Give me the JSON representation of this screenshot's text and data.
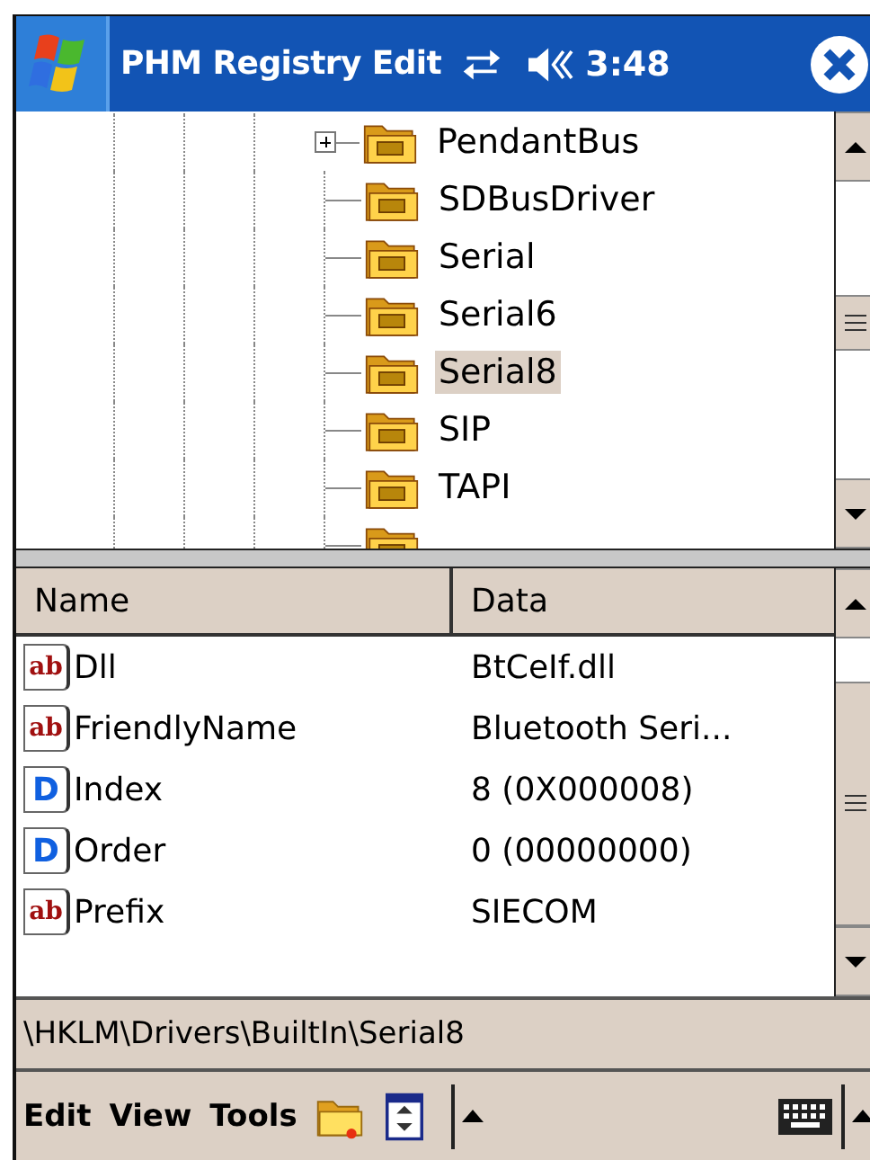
{
  "title_bar": {
    "title": "PHM Registry Edit",
    "time": "3:48"
  },
  "tree": {
    "items": [
      {
        "label": "PendantBus",
        "expandable": true,
        "selected": false
      },
      {
        "label": "SDBusDriver",
        "expandable": false,
        "selected": false
      },
      {
        "label": "Serial",
        "expandable": false,
        "selected": false
      },
      {
        "label": "Serial6",
        "expandable": false,
        "selected": false
      },
      {
        "label": "Serial8",
        "expandable": false,
        "selected": true
      },
      {
        "label": "SIP",
        "expandable": false,
        "selected": false
      },
      {
        "label": "TAPI",
        "expandable": false,
        "selected": false
      }
    ]
  },
  "values": {
    "columns": [
      "Name",
      "Data"
    ],
    "rows": [
      {
        "kind": "string",
        "type_label": "ab",
        "name": "Dll",
        "data": "BtCeIf.dll"
      },
      {
        "kind": "string",
        "type_label": "ab",
        "name": "FriendlyName",
        "data": "Bluetooth Seri..."
      },
      {
        "kind": "dword",
        "type_label": "D",
        "name": "Index",
        "data": "8 (0X000008)"
      },
      {
        "kind": "dword",
        "type_label": "D",
        "name": "Order",
        "data": "0 (00000000)"
      },
      {
        "kind": "string",
        "type_label": "ab",
        "name": "Prefix",
        "data": "SIECOM"
      }
    ]
  },
  "status_bar": {
    "path": "\\HKLM\\Drivers\\BuiltIn\\Serial8"
  },
  "menu_bar": {
    "items": [
      "Edit",
      "View",
      "Tools"
    ]
  }
}
